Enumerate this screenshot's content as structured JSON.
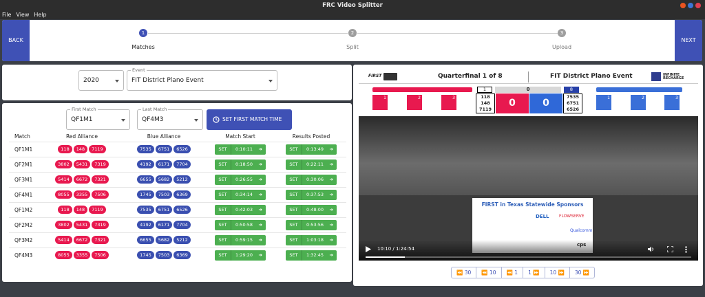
{
  "window": {
    "title": "FRC Video Splitter"
  },
  "menu": [
    "File",
    "View",
    "Help"
  ],
  "stepper": {
    "back": "BACK",
    "next": "NEXT",
    "steps": [
      {
        "num": "1",
        "label": "Matches"
      },
      {
        "num": "2",
        "label": "Split"
      },
      {
        "num": "3",
        "label": "Upload"
      }
    ]
  },
  "event_panel": {
    "year": "2020",
    "event_label": "Event",
    "event": "FIT District Plano Event"
  },
  "match_panel": {
    "first_match_label": "First Match",
    "first_match": "QF1M1",
    "last_match_label": "Last Match",
    "last_match": "QF4M3",
    "set_first_button": "SET FIRST MATCH TIME",
    "columns": [
      "Match",
      "Red Alliance",
      "Blue Alliance",
      "Match Start",
      "Results Posted"
    ],
    "set_label": "SET",
    "rows": [
      {
        "match": "QF1M1",
        "red": [
          "118",
          "148",
          "7119"
        ],
        "blue": [
          "7535",
          "6751",
          "6526"
        ],
        "start": "0:10:11",
        "posted": "0:13:49"
      },
      {
        "match": "QF2M1",
        "red": [
          "3802",
          "5431",
          "7319"
        ],
        "blue": [
          "4192",
          "6171",
          "7704"
        ],
        "start": "0:18:50",
        "posted": "0:22:11"
      },
      {
        "match": "QF3M1",
        "red": [
          "5414",
          "6672",
          "7321"
        ],
        "blue": [
          "6655",
          "5682",
          "5212"
        ],
        "start": "0:26:55",
        "posted": "0:30:06"
      },
      {
        "match": "QF4M1",
        "red": [
          "8055",
          "3355",
          "7506"
        ],
        "blue": [
          "1745",
          "7503",
          "6369"
        ],
        "start": "0:34:14",
        "posted": "0:37:53"
      },
      {
        "match": "QF1M2",
        "red": [
          "118",
          "148",
          "7119"
        ],
        "blue": [
          "7535",
          "6751",
          "6526"
        ],
        "start": "0:42:03",
        "posted": "0:48:00"
      },
      {
        "match": "QF2M2",
        "red": [
          "3802",
          "5431",
          "7319"
        ],
        "blue": [
          "4192",
          "6171",
          "7704"
        ],
        "start": "0:50:58",
        "posted": "0:53:56"
      },
      {
        "match": "QF3M2",
        "red": [
          "5414",
          "6672",
          "7321"
        ],
        "blue": [
          "6655",
          "5682",
          "5212"
        ],
        "start": "0:59:15",
        "posted": "1:03:18"
      },
      {
        "match": "QF4M3",
        "red": [
          "8055",
          "3355",
          "7506"
        ],
        "blue": [
          "1745",
          "7503",
          "6369"
        ],
        "start": "1:29:20",
        "posted": "1:32:45"
      }
    ]
  },
  "video": {
    "overlay_title": "Quarterfinal 1 of 8",
    "overlay_event": "FIT District Plano Event",
    "game_logo": "INFINITE RECHARGE",
    "brand": "FIRST",
    "red_seed": "1",
    "blue_seed": "8",
    "series": "0",
    "red_teams": [
      "118",
      "148",
      "7119"
    ],
    "blue_teams": [
      "7535",
      "6751",
      "6526"
    ],
    "red_score": "0",
    "blue_score": "0",
    "robot_nums": [
      "1",
      "2",
      "3"
    ],
    "sponsor_title": "FIRST in Texas Statewide Sponsors",
    "sponsors": [
      "DELL",
      "FLOWSERVE",
      "Qualcomm",
      "cps"
    ],
    "time": "10:10 / 1:24:54",
    "progress": 0.12
  },
  "jump_buttons": [
    "30",
    "10",
    "1",
    "1",
    "10",
    "30"
  ],
  "colors": {
    "primary": "#3f51b5",
    "red": "#e8194f",
    "blue": "#3a4fb0",
    "green": "#4caf50"
  }
}
